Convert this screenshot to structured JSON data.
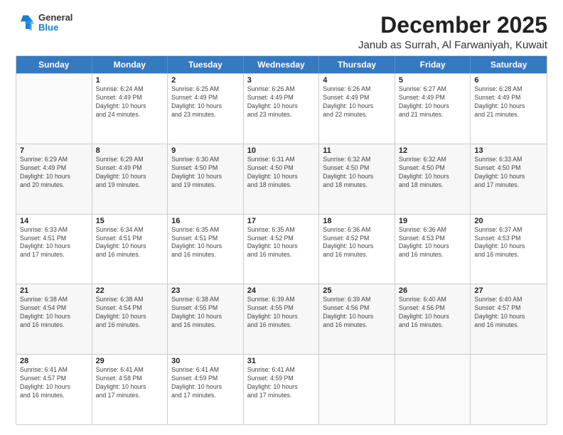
{
  "header": {
    "logo": {
      "general": "General",
      "blue": "Blue"
    },
    "title": "December 2025",
    "location": "Janub as Surrah, Al Farwaniyah, Kuwait"
  },
  "calendar": {
    "days": [
      "Sunday",
      "Monday",
      "Tuesday",
      "Wednesday",
      "Thursday",
      "Friday",
      "Saturday"
    ],
    "rows": [
      [
        {
          "day": "",
          "info": ""
        },
        {
          "day": "1",
          "info": "Sunrise: 6:24 AM\nSunset: 4:49 PM\nDaylight: 10 hours\nand 24 minutes."
        },
        {
          "day": "2",
          "info": "Sunrise: 6:25 AM\nSunset: 4:49 PM\nDaylight: 10 hours\nand 23 minutes."
        },
        {
          "day": "3",
          "info": "Sunrise: 6:26 AM\nSunset: 4:49 PM\nDaylight: 10 hours\nand 23 minutes."
        },
        {
          "day": "4",
          "info": "Sunrise: 6:26 AM\nSunset: 4:49 PM\nDaylight: 10 hours\nand 22 minutes."
        },
        {
          "day": "5",
          "info": "Sunrise: 6:27 AM\nSunset: 4:49 PM\nDaylight: 10 hours\nand 21 minutes."
        },
        {
          "day": "6",
          "info": "Sunrise: 6:28 AM\nSunset: 4:49 PM\nDaylight: 10 hours\nand 21 minutes."
        }
      ],
      [
        {
          "day": "7",
          "info": "Sunrise: 6:29 AM\nSunset: 4:49 PM\nDaylight: 10 hours\nand 20 minutes."
        },
        {
          "day": "8",
          "info": "Sunrise: 6:29 AM\nSunset: 4:49 PM\nDaylight: 10 hours\nand 19 minutes."
        },
        {
          "day": "9",
          "info": "Sunrise: 6:30 AM\nSunset: 4:50 PM\nDaylight: 10 hours\nand 19 minutes."
        },
        {
          "day": "10",
          "info": "Sunrise: 6:31 AM\nSunset: 4:50 PM\nDaylight: 10 hours\nand 18 minutes."
        },
        {
          "day": "11",
          "info": "Sunrise: 6:32 AM\nSunset: 4:50 PM\nDaylight: 10 hours\nand 18 minutes."
        },
        {
          "day": "12",
          "info": "Sunrise: 6:32 AM\nSunset: 4:50 PM\nDaylight: 10 hours\nand 18 minutes."
        },
        {
          "day": "13",
          "info": "Sunrise: 6:33 AM\nSunset: 4:50 PM\nDaylight: 10 hours\nand 17 minutes."
        }
      ],
      [
        {
          "day": "14",
          "info": "Sunrise: 6:33 AM\nSunset: 4:51 PM\nDaylight: 10 hours\nand 17 minutes."
        },
        {
          "day": "15",
          "info": "Sunrise: 6:34 AM\nSunset: 4:51 PM\nDaylight: 10 hours\nand 16 minutes."
        },
        {
          "day": "16",
          "info": "Sunrise: 6:35 AM\nSunset: 4:51 PM\nDaylight: 10 hours\nand 16 minutes."
        },
        {
          "day": "17",
          "info": "Sunrise: 6:35 AM\nSunset: 4:52 PM\nDaylight: 10 hours\nand 16 minutes."
        },
        {
          "day": "18",
          "info": "Sunrise: 6:36 AM\nSunset: 4:52 PM\nDaylight: 10 hours\nand 16 minutes."
        },
        {
          "day": "19",
          "info": "Sunrise: 6:36 AM\nSunset: 4:53 PM\nDaylight: 10 hours\nand 16 minutes."
        },
        {
          "day": "20",
          "info": "Sunrise: 6:37 AM\nSunset: 4:53 PM\nDaylight: 10 hours\nand 16 minutes."
        }
      ],
      [
        {
          "day": "21",
          "info": "Sunrise: 6:38 AM\nSunset: 4:54 PM\nDaylight: 10 hours\nand 16 minutes."
        },
        {
          "day": "22",
          "info": "Sunrise: 6:38 AM\nSunset: 4:54 PM\nDaylight: 10 hours\nand 16 minutes."
        },
        {
          "day": "23",
          "info": "Sunrise: 6:38 AM\nSunset: 4:55 PM\nDaylight: 10 hours\nand 16 minutes."
        },
        {
          "day": "24",
          "info": "Sunrise: 6:39 AM\nSunset: 4:55 PM\nDaylight: 10 hours\nand 16 minutes."
        },
        {
          "day": "25",
          "info": "Sunrise: 6:39 AM\nSunset: 4:56 PM\nDaylight: 10 hours\nand 16 minutes."
        },
        {
          "day": "26",
          "info": "Sunrise: 6:40 AM\nSunset: 4:56 PM\nDaylight: 10 hours\nand 16 minutes."
        },
        {
          "day": "27",
          "info": "Sunrise: 6:40 AM\nSunset: 4:57 PM\nDaylight: 10 hours\nand 16 minutes."
        }
      ],
      [
        {
          "day": "28",
          "info": "Sunrise: 6:41 AM\nSunset: 4:57 PM\nDaylight: 10 hours\nand 16 minutes."
        },
        {
          "day": "29",
          "info": "Sunrise: 6:41 AM\nSunset: 4:58 PM\nDaylight: 10 hours\nand 17 minutes."
        },
        {
          "day": "30",
          "info": "Sunrise: 6:41 AM\nSunset: 4:59 PM\nDaylight: 10 hours\nand 17 minutes."
        },
        {
          "day": "31",
          "info": "Sunrise: 6:41 AM\nSunset: 4:59 PM\nDaylight: 10 hours\nand 17 minutes."
        },
        {
          "day": "",
          "info": ""
        },
        {
          "day": "",
          "info": ""
        },
        {
          "day": "",
          "info": ""
        }
      ]
    ]
  }
}
